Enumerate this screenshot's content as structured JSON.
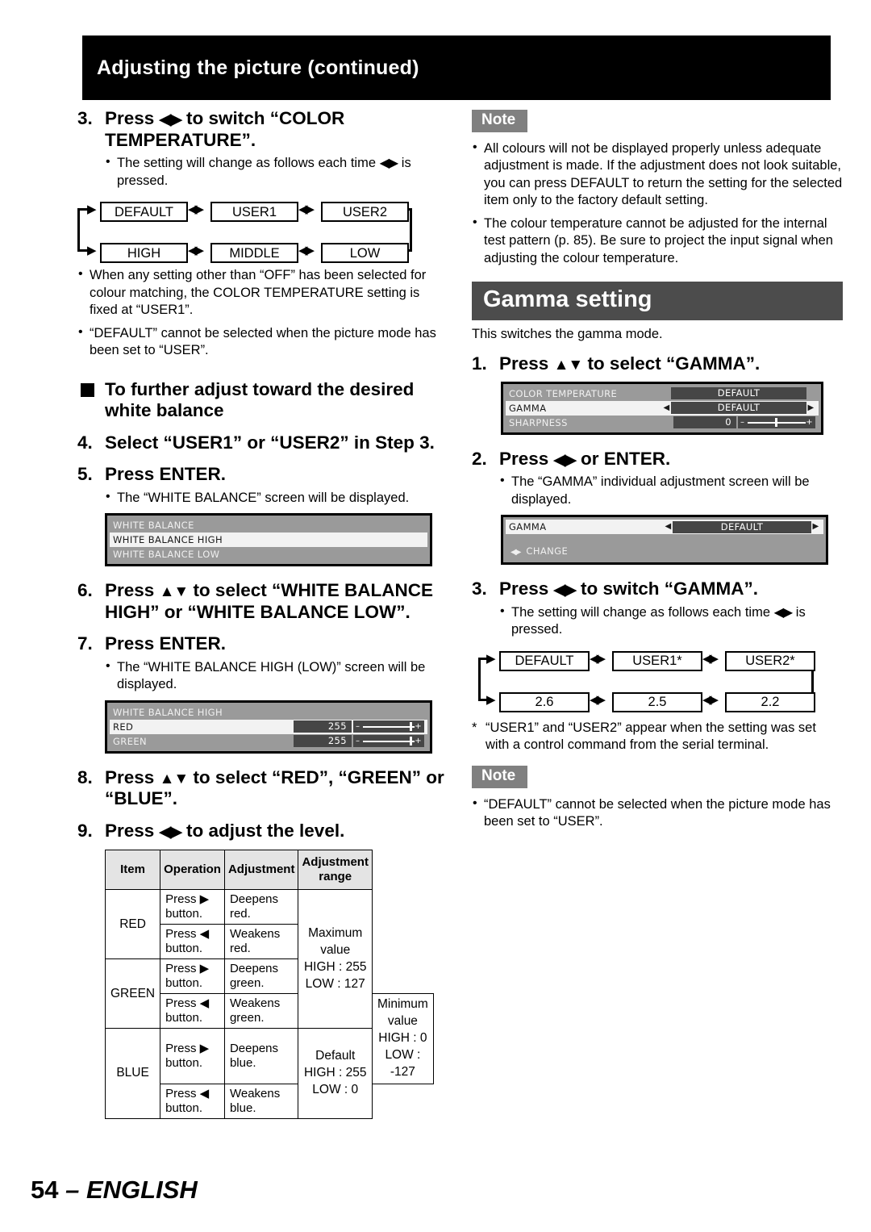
{
  "header": {
    "title": "Adjusting the picture (continued)"
  },
  "left": {
    "step3": {
      "num": "3.",
      "text_pre": "Press ",
      "arrows": "◀▶",
      "text_post": " to switch “COLOR TEMPERATURE”.",
      "bullet_pre": "The setting will change as follows each time ",
      "bullet_arrows": "◀▶",
      "bullet_post": " is pressed."
    },
    "color_temp_flow": {
      "row1": [
        "DEFAULT",
        "USER1",
        "USER2"
      ],
      "row2": [
        "HIGH",
        "MIDDLE",
        "LOW"
      ]
    },
    "bullets_after_flow": [
      "When any setting other than “OFF” has been selected for colour matching, the COLOR TEMPERATURE setting is fixed at “USER1”.",
      "“DEFAULT” cannot be selected when the picture mode has been set to “USER”."
    ],
    "sq_heading": "To further adjust toward the desired white balance",
    "step4": {
      "num": "4.",
      "text": "Select “USER1” or “USER2” in Step 3."
    },
    "step5": {
      "num": "5.",
      "text": "Press ENTER.",
      "bullet": "The “WHITE BALANCE” screen will be displayed."
    },
    "osd_white_balance": {
      "title": "WHITE BALANCE",
      "rows": [
        {
          "label": "WHITE BALANCE HIGH",
          "state": "selected"
        },
        {
          "label": "WHITE BALANCE LOW",
          "state": "plain"
        }
      ]
    },
    "step6": {
      "num": "6.",
      "text_pre": "Press ",
      "arrows": "▲▼",
      "text_post": " to select “WHITE BALANCE HIGH” or “WHITE BALANCE LOW”."
    },
    "step7": {
      "num": "7.",
      "text": "Press ENTER.",
      "bullet": "The “WHITE BALANCE HIGH (LOW)” screen will be displayed."
    },
    "osd_wb_high": {
      "title": "WHITE BALANCE HIGH",
      "rows": [
        {
          "label": "RED",
          "value": "255",
          "state": "selected"
        },
        {
          "label": "GREEN",
          "value": "255",
          "state": "plain"
        }
      ]
    },
    "step8": {
      "num": "8.",
      "text_pre": "Press ",
      "arrows": "▲▼",
      "text_post": " to select “RED”, “GREEN” or “BLUE”."
    },
    "step9": {
      "num": "9.",
      "text_pre": "Press ",
      "arrows": "◀▶",
      "text_post": " to adjust the level."
    },
    "table": {
      "headers": [
        "Item",
        "Operation",
        "Adjustment",
        "Adjustment range"
      ],
      "groups": [
        {
          "item": "RED",
          "rows": [
            {
              "operation_pre": "Press ",
              "operation_arrow": "▶",
              "operation_post": " button.",
              "adjustment": "Deepens red."
            },
            {
              "operation_pre": "Press ",
              "operation_arrow": "◀",
              "operation_post": " button.",
              "adjustment": "Weakens red."
            }
          ],
          "range": [
            "Maximum",
            "value",
            "HIGH : 255",
            "LOW : 127"
          ]
        },
        {
          "item": "GREEN",
          "rows": [
            {
              "operation_pre": "Press ",
              "operation_arrow": "▶",
              "operation_post": " button.",
              "adjustment": "Deepens green."
            },
            {
              "operation_pre": "Press ",
              "operation_arrow": "◀",
              "operation_post": " button.",
              "adjustment": "Weakens green."
            }
          ],
          "range": [
            "Minimum",
            "value",
            "HIGH : 0",
            "LOW : -127"
          ]
        },
        {
          "item": "BLUE",
          "rows": [
            {
              "operation_pre": "Press ",
              "operation_arrow": "▶",
              "operation_post": " button.",
              "adjustment": "Deepens blue."
            },
            {
              "operation_pre": "Press ",
              "operation_arrow": "◀",
              "operation_post": " button.",
              "adjustment": "Weakens blue."
            }
          ],
          "range": [
            "Default",
            "HIGH : 255",
            "LOW : 0"
          ]
        }
      ]
    }
  },
  "right": {
    "note1": {
      "label": "Note",
      "items": [
        "All colours will not be displayed properly unless adequate adjustment is made. If the adjustment does not look suitable, you can press DEFAULT to return the setting for the selected item only to the factory default setting.",
        "The colour temperature cannot be adjusted for the internal test pattern (p. 85). Be sure to project the input signal when adjusting the colour temperature."
      ]
    },
    "section": {
      "title": "Gamma setting",
      "subtitle": "This switches the gamma mode."
    },
    "step1": {
      "num": "1.",
      "text_pre": "Press ",
      "arrows": "▲▼",
      "text_post": " to select “GAMMA”."
    },
    "osd_menu": {
      "rows": [
        {
          "label": "COLOR  TEMPERATURE",
          "value": "DEFAULT",
          "state": "plain",
          "carets": false,
          "slider": false
        },
        {
          "label": "GAMMA",
          "value": "DEFAULT",
          "state": "selected",
          "carets": true,
          "slider": false
        },
        {
          "label": "SHARPNESS",
          "value": "0",
          "state": "plain",
          "carets": false,
          "slider": true
        }
      ]
    },
    "step2": {
      "num": "2.",
      "text_pre": "Press ",
      "arrows": "◀▶",
      "text_post": " or ENTER.",
      "bullet": "The “GAMMA” individual adjustment screen will be displayed."
    },
    "osd_gamma": {
      "label": "GAMMA",
      "value": "DEFAULT",
      "change_arrows": "◀▶",
      "change_label": "CHANGE"
    },
    "step3": {
      "num": "3.",
      "text_pre": "Press ",
      "arrows": "◀▶",
      "text_post": " to switch “GAMMA”.",
      "bullet_pre": "The setting will change as follows each time ",
      "bullet_arrows": "◀▶",
      "bullet_post": " is pressed."
    },
    "gamma_flow": {
      "row1": [
        "DEFAULT",
        "USER1*",
        "USER2*"
      ],
      "row2": [
        "2.6",
        "2.5",
        "2.2"
      ]
    },
    "footnote": {
      "star": "*",
      "text": "“USER1” and “USER2” appear when the setting was set with a control command from the serial terminal."
    },
    "note2": {
      "label": "Note",
      "items": [
        "“DEFAULT” cannot be selected when the picture mode has been set to “USER”."
      ]
    }
  },
  "footer": {
    "page": "54",
    "dash_lang": "– ENGLISH"
  }
}
